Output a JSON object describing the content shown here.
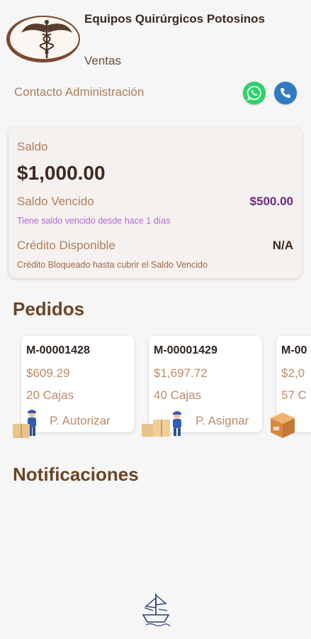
{
  "header": {
    "company_name": "Equipos Quirúrgicos Potosinos",
    "role": "Ventas",
    "logo_icon": "caduceus-logo"
  },
  "contact": {
    "label": "Contacto Administración",
    "whatsapp_icon": "whatsapp-icon",
    "phone_icon": "phone-icon"
  },
  "balance": {
    "label": "Saldo",
    "amount": "$1,000.00",
    "overdue_label": "Saldo Vencido",
    "overdue_amount": "$500.00",
    "overdue_note": "Tiene saldo vencido desde hace 1 días",
    "credit_label": "Crédito Disponible",
    "credit_value": "N/A",
    "credit_note": "Crédito Bloqueado hasta cubrir el Saldo Vencido"
  },
  "orders": {
    "title": "Pedidos",
    "items": [
      {
        "id": "M-00001428",
        "total": "$609.29",
        "boxes": "20 Cajas",
        "status": "P. Autorizar",
        "icon": "worker-with-box-icon"
      },
      {
        "id": "M-00001429",
        "total": "$1,697.72",
        "boxes": "40 Cajas",
        "status": "P. Asignar",
        "icon": "boxes-with-worker-icon"
      },
      {
        "id": "M-00",
        "total": "$2,0",
        "boxes": "57 C",
        "status": "",
        "icon": "cardboard-box-icon"
      }
    ]
  },
  "notifications": {
    "title": "Notificaciones"
  },
  "footer": {
    "icon": "ship-sketch-icon"
  },
  "colors": {
    "brown_dark": "#3b2a20",
    "brown_accent": "#b07d5a",
    "purple_overdue": "#6a2a8a",
    "whatsapp_green": "#2bd36a",
    "phone_blue": "#2f7cc1"
  }
}
